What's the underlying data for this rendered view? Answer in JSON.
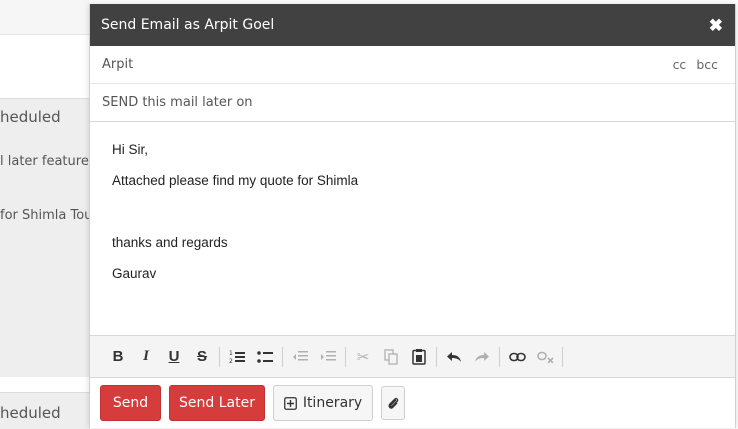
{
  "background": {
    "scheduled_1": "heduled",
    "later_feature": "l later feature",
    "shimla_tour": " for Shimla Tou",
    "scheduled_2": "heduled"
  },
  "modal": {
    "title": "Send Email as Arpit Goel",
    "close_icon": "close-icon",
    "to_value": "Arpit",
    "cc_label": "cc",
    "bcc_label": "bcc",
    "subject": "SEND this mail later on",
    "body_lines": [
      "Hi Sir,",
      "Attached please find my quote for Shimla",
      "",
      "thanks and regards",
      "Gaurav"
    ]
  },
  "toolbar": {
    "bold": "B",
    "italic": "I",
    "underline": "U",
    "strike": "S"
  },
  "actions": {
    "send": "Send",
    "send_later": "Send Later",
    "itinerary": "Itinerary",
    "itinerary_icon": "plus-square-icon",
    "attach_icon": "paperclip-icon"
  },
  "colors": {
    "header_bg": "#414141",
    "primary_red": "#d63c3c"
  }
}
